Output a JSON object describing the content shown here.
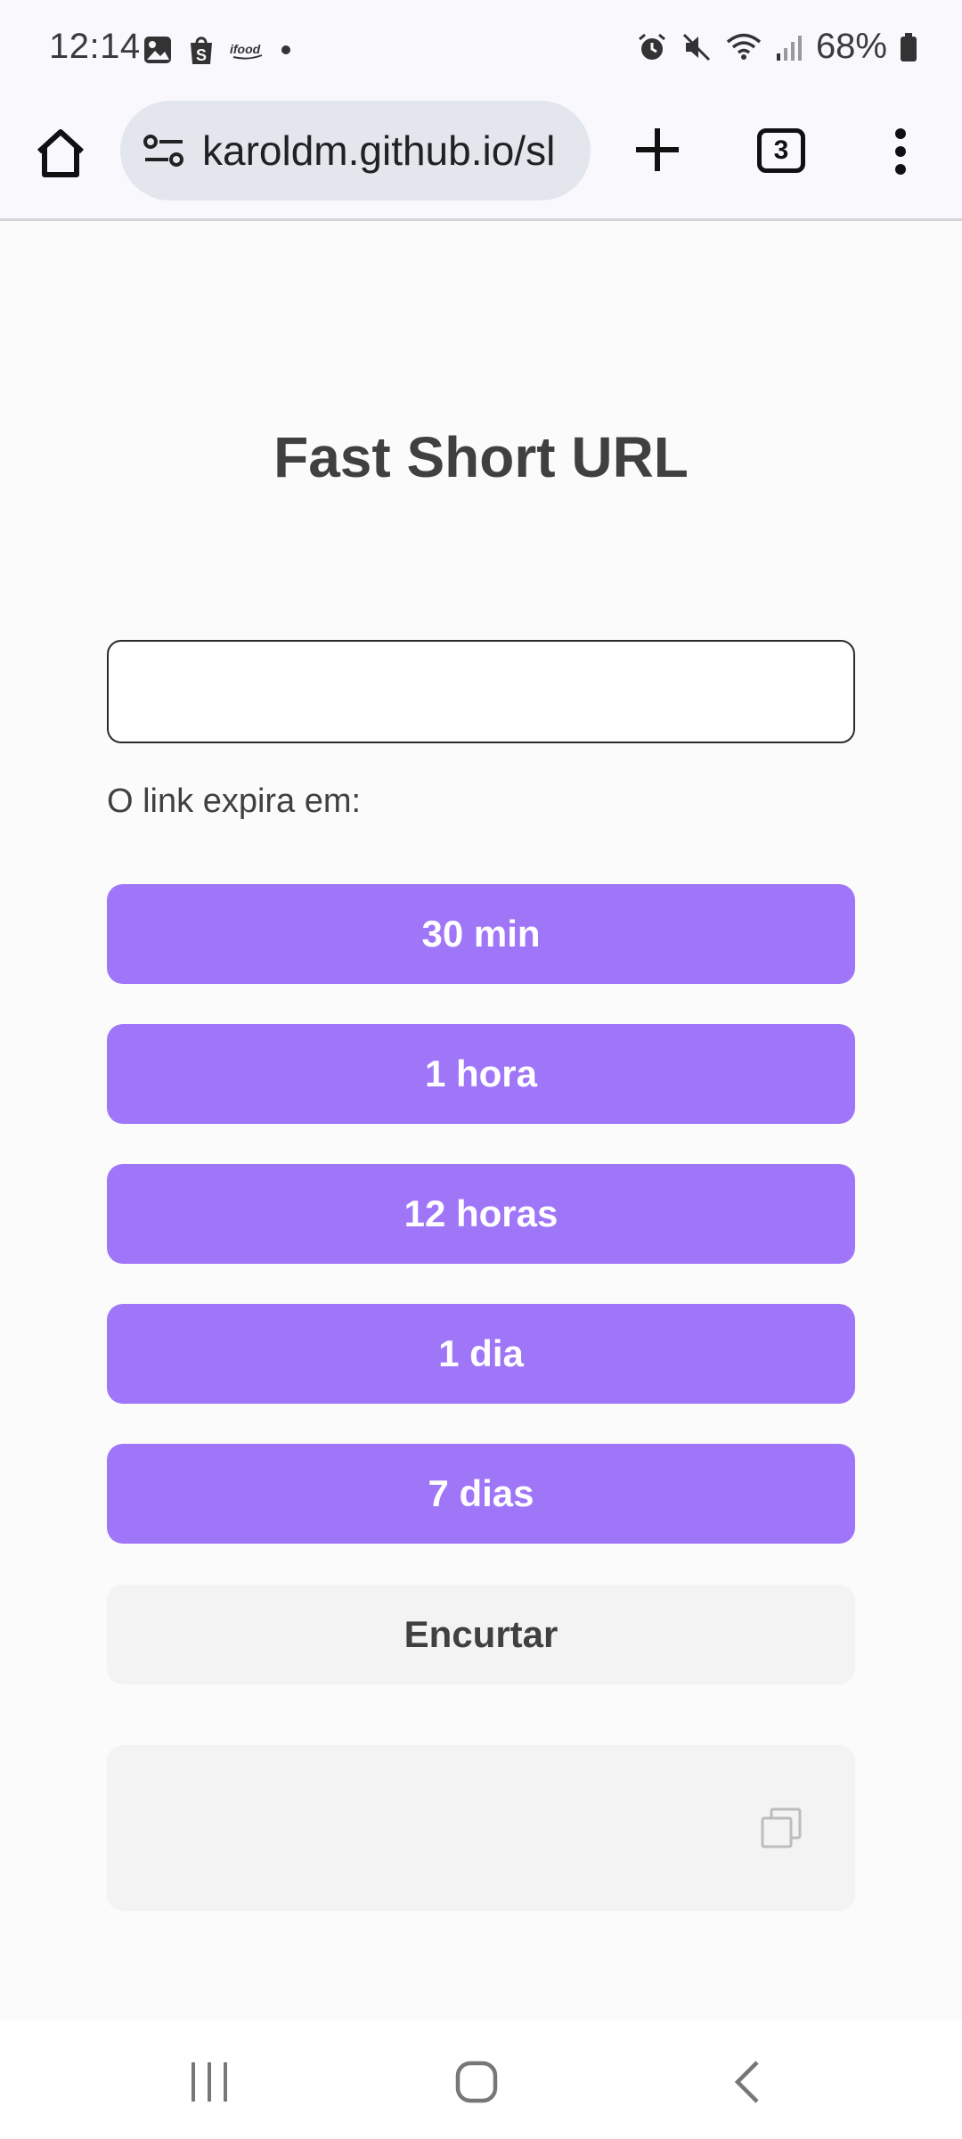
{
  "status_bar": {
    "time": "12:14",
    "battery": "68%",
    "left_icons": [
      "image-icon",
      "shop-icon",
      "ifood-icon",
      "dot-icon"
    ],
    "right_icons": [
      "alarm-icon",
      "mute-icon",
      "wifi-icon",
      "signal-icon",
      "battery-icon"
    ]
  },
  "browser": {
    "url": "karoldm.github.io/sl",
    "tab_count": "3"
  },
  "page": {
    "title": "Fast Short URL",
    "input_value": "",
    "expire_label": "O link expira em:",
    "options": [
      {
        "label": "30 min"
      },
      {
        "label": "1 hora"
      },
      {
        "label": "12 horas"
      },
      {
        "label": "1 dia"
      },
      {
        "label": "7 dias"
      }
    ],
    "shorten_label": "Encurtar",
    "result_text": ""
  },
  "colors": {
    "accent": "#a076f9",
    "secondary_button": "#f3f3f3",
    "text": "#404040"
  }
}
